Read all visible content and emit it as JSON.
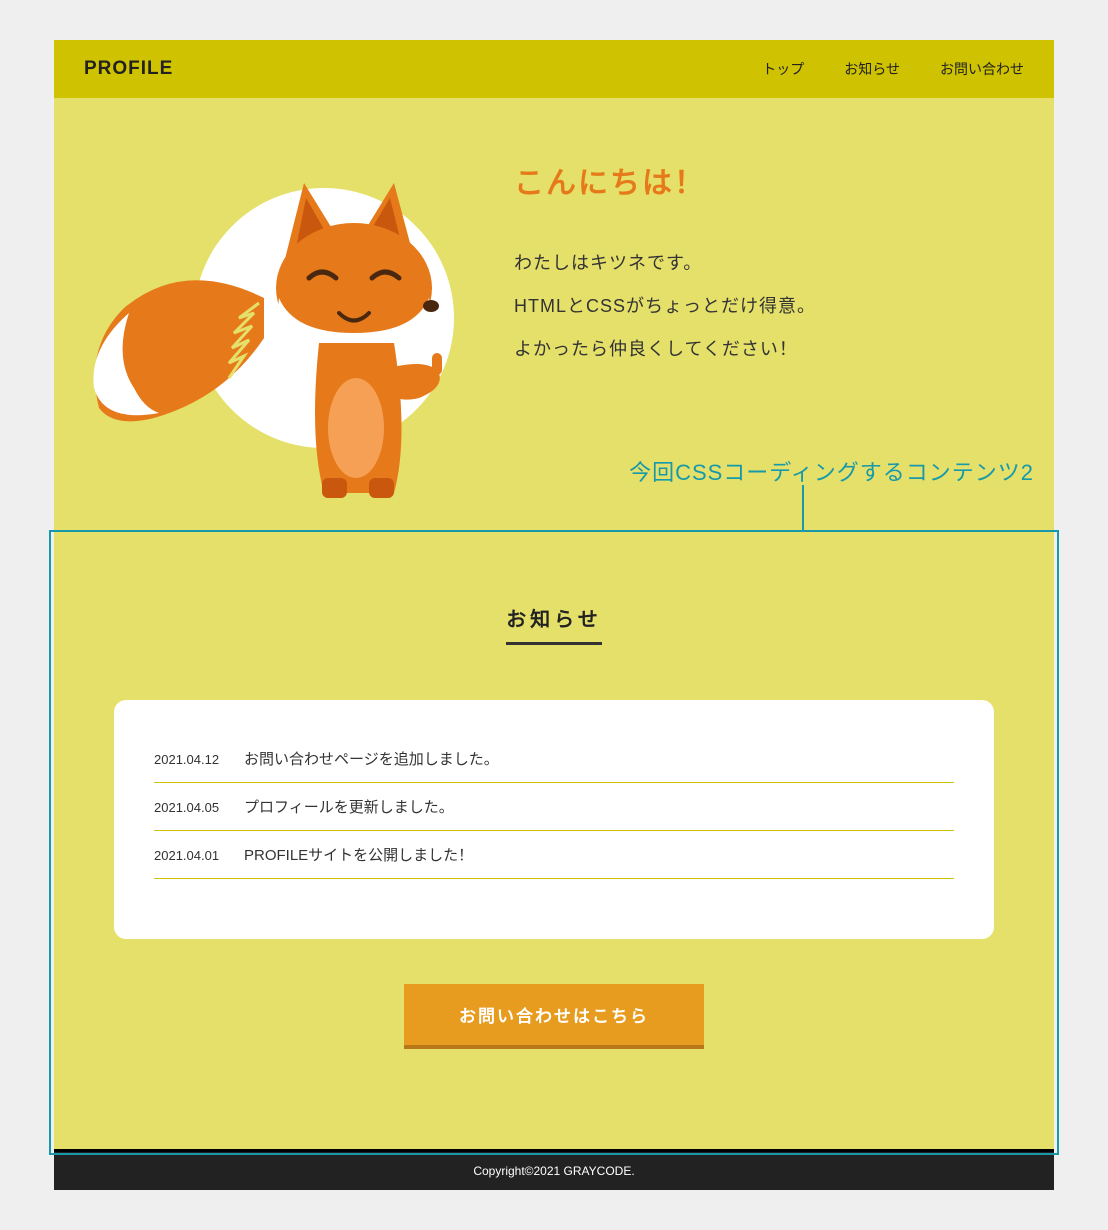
{
  "header": {
    "title": "PROFILE",
    "nav": {
      "top": "トップ",
      "news": "お知らせ",
      "contact": "お問い合わせ"
    }
  },
  "hero": {
    "title": "こんにちは！",
    "line1": "わたしはキツネです。",
    "line2": "HTMLとCSSがちょっとだけ得意。",
    "line3": "よかったら仲良くしてください！"
  },
  "annotation": {
    "label": "今回CSSコーディングするコンテンツ2"
  },
  "news": {
    "heading": "お知らせ",
    "items": [
      {
        "date": "2021.04.12",
        "text": "お問い合わせページを追加しました。"
      },
      {
        "date": "2021.04.05",
        "text": "プロフィールを更新しました。"
      },
      {
        "date": "2021.04.01",
        "text": "PROFILEサイトを公開しました！"
      }
    ],
    "button": "お問い合わせはこちら"
  },
  "footer": {
    "copyright": "Copyright©2021 GRAYCODE."
  },
  "colors": {
    "headerBg": "#cfc200",
    "pageBg": "#e4e06a",
    "accent": "#e67a1a",
    "button": "#e89c1f",
    "annotation": "#1799aa"
  }
}
